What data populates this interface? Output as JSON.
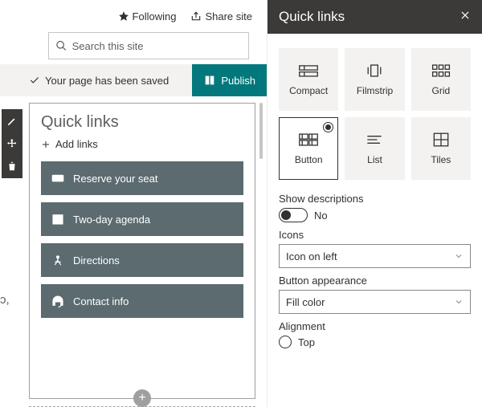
{
  "topbar": {
    "following": "Following",
    "share": "Share site"
  },
  "search": {
    "placeholder": "Search this site"
  },
  "statusbar": {
    "saved": "Your page has been saved",
    "publish": "Publish"
  },
  "webpart": {
    "title": "Quick links",
    "add": "Add links",
    "items": [
      {
        "label": "Reserve your seat"
      },
      {
        "label": "Two-day agenda"
      },
      {
        "label": "Directions"
      },
      {
        "label": "Contact info"
      }
    ]
  },
  "pane": {
    "title": "Quick links",
    "layouts": [
      {
        "label": "Compact"
      },
      {
        "label": "Filmstrip"
      },
      {
        "label": "Grid"
      },
      {
        "label": "Button"
      },
      {
        "label": "List"
      },
      {
        "label": "Tiles"
      }
    ],
    "show_descriptions_label": "Show descriptions",
    "show_descriptions_value": "No",
    "icons_label": "Icons",
    "icons_value": "Icon on left",
    "button_appearance_label": "Button appearance",
    "button_appearance_value": "Fill color",
    "alignment_label": "Alignment",
    "alignment_value": "Top"
  },
  "left_edge_text": "ɔ,"
}
